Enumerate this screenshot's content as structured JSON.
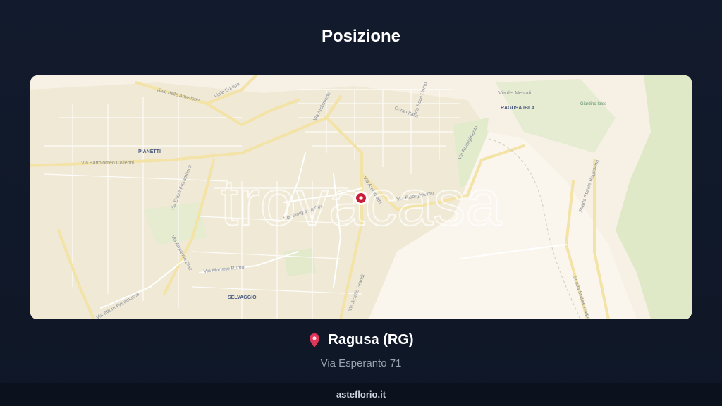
{
  "header": {
    "title": "Posizione"
  },
  "map": {
    "watermark": "trovacasa",
    "marker_color": "#c81e3a",
    "labels": {
      "viale_americhe": "Viale delle Americhe",
      "viale_europa": "Viale Europa",
      "via_archimede_top": "Via Archimede",
      "corso_italia": "Corso Italia",
      "via_ecce_homo": "Via Ecce Homo",
      "via_mercati": "Via del Mercati",
      "ragusa_ibla": "RAGUSA IBLA",
      "giardino_ibleo": "Giardino Ibleo",
      "via_colleoni": "Via Bartolomeo Colleoni",
      "pianetti": "PIANETTI",
      "via_risorgimento_mid": "Via Risorgimento",
      "via_risorgimento_right": "Via Risorgimento",
      "via_archimede_mid": "Via Archimede",
      "strada_statale": "Strada Statale Ragusana",
      "via_ettore_fieramosca": "Via Ettore Fieramosca",
      "via_giorgio_la_pira": "Via Giorgio La Pira",
      "via_carrara": "Via Mariano Rumor",
      "via_armando_diaz": "Via Armando Diaz",
      "via_achille_grandi": "Via Achille Grandi",
      "selvaggio": "SELVAGGIO",
      "via_ettore_fieramosca_low": "Via Ettore Fieramosca",
      "strada_statale_low": "Strada Statale Ragusana"
    }
  },
  "location": {
    "city": "Ragusa (RG)",
    "address": "Via Esperanto 71",
    "pin_icon": "map-pin-icon"
  },
  "footer": {
    "site": "asteflorio.it"
  }
}
